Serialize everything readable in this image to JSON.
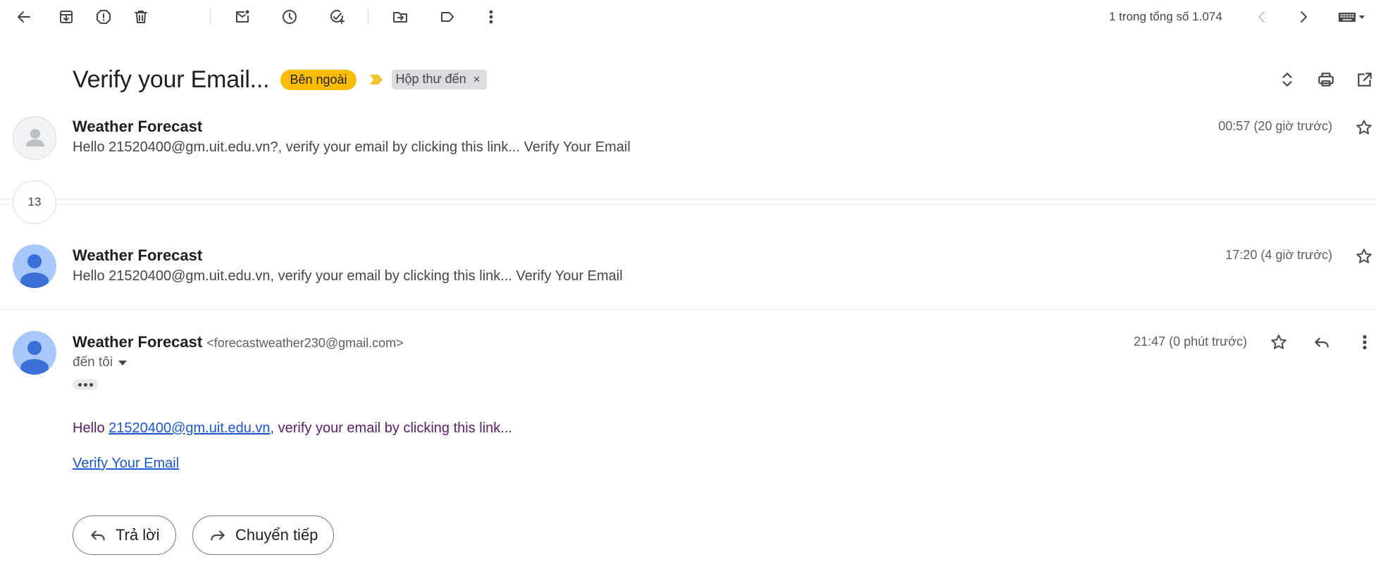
{
  "toolbar": {
    "back": "back",
    "archive": "archive",
    "report_spam": "report-spam",
    "delete": "delete",
    "mark_unread": "mark-unread",
    "snooze": "snooze",
    "add_task": "add-task",
    "move_to": "move-to",
    "labels": "labels",
    "more": "more",
    "pager_text": "1 trong tổng số 1.074",
    "input_tools": "keyboard"
  },
  "thread": {
    "subject": "Verify your Email...",
    "label_external": "Bên ngoài",
    "label_inbox": "Hộp thư đến",
    "label_inbox_remove": "×",
    "colors": {
      "external_chip": "#fbbc04",
      "importance_marker": "#f4c430",
      "inbox_chip": "#dadce0",
      "link": "#1a57d6",
      "body_text": "#5b1b6e"
    }
  },
  "messages": {
    "first": {
      "sender": "Weather Forecast",
      "snippet": "Hello 21520400@gm.uit.edu.vn?, verify your email by clicking this link... Verify Your Email",
      "time": "00:57 (20 giờ trước)"
    },
    "collapsed_count": "13",
    "second": {
      "sender": "Weather Forecast",
      "snippet": "Hello 21520400@gm.uit.edu.vn, verify your email by clicking this link... Verify Your Email",
      "time": "17:20 (4 giờ trước)"
    },
    "open": {
      "sender": "Weather Forecast",
      "sender_email": "<forecastweather230@gmail.com>",
      "time": "21:47 (0 phút trước)",
      "to_me": "đến tôi",
      "body_prefix": "Hello ",
      "body_email": "21520400@gm.uit.edu.vn",
      "body_suffix": ", verify your email by clicking this link...",
      "verify_link": "Verify Your Email"
    }
  },
  "actions": {
    "reply_label": "Trả lời",
    "forward_label": "Chuyển tiếp"
  }
}
